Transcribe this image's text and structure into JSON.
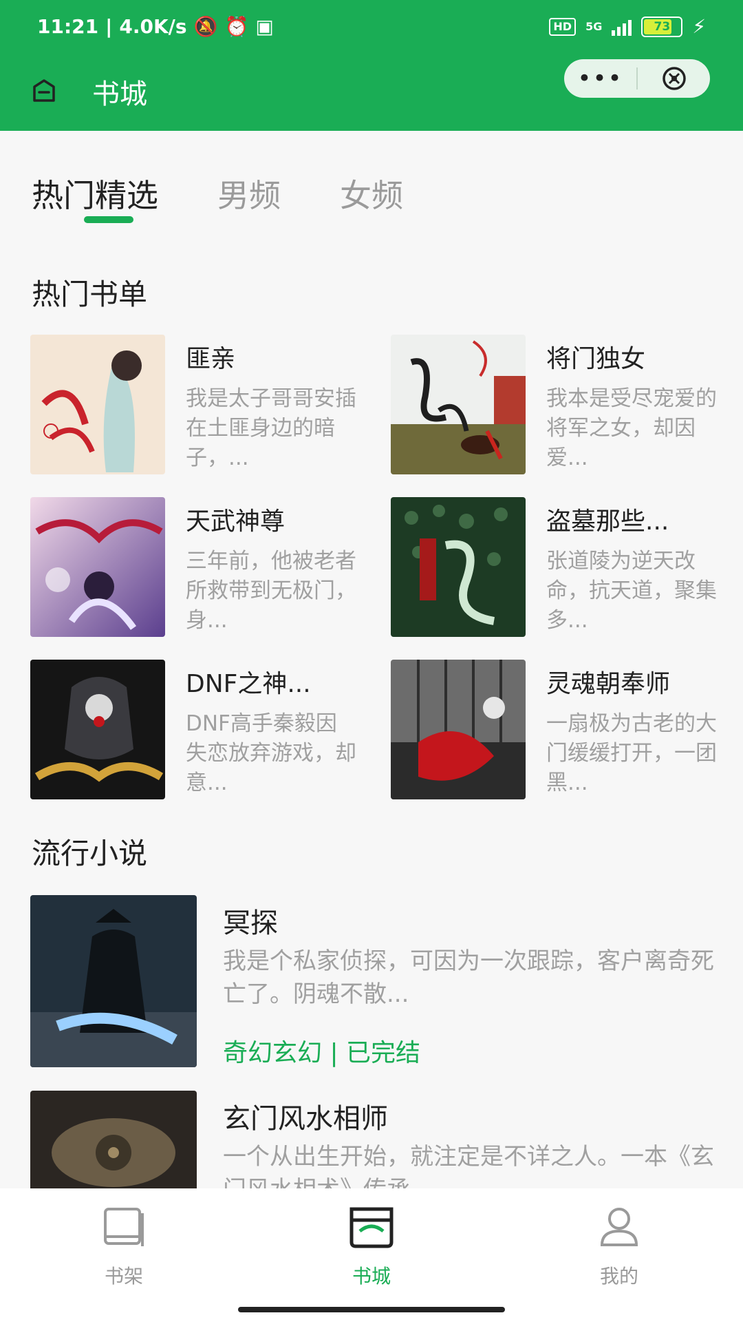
{
  "status_bar": {
    "time": "11:21",
    "net_speed": "4.0K/s",
    "hd_badge": "HD",
    "network": "5G",
    "battery": "73"
  },
  "header": {
    "title": "书城",
    "more_label": "•••"
  },
  "tabs": [
    {
      "label": "热门精选",
      "active": true
    },
    {
      "label": "男频",
      "active": false
    },
    {
      "label": "女频",
      "active": false
    }
  ],
  "hot_booklist": {
    "title": "热门书单",
    "items": [
      {
        "title": "匪亲",
        "desc": "我是太子哥哥安插在土匪身边的暗子，..."
      },
      {
        "title": "将门独女",
        "desc": "我本是受尽宠爱的将军之女，却因爱..."
      },
      {
        "title": "天武神尊",
        "desc": "三年前，他被老者所救带到无极门，身..."
      },
      {
        "title": "盗墓那些...",
        "desc": "张道陵为逆天改命，抗天道，聚集多..."
      },
      {
        "title": "DNF之神...",
        "desc": "DNF高手秦毅因失恋放弃游戏，却意..."
      },
      {
        "title": "灵魂朝奉师",
        "desc": "一扇极为古老的大门缓缓打开，一团黑..."
      }
    ]
  },
  "popular_novels": {
    "title": "流行小说",
    "items": [
      {
        "title": "冥探",
        "desc": "我是个私家侦探，可因为一次跟踪，客户离奇死亡了。阴魂不散...",
        "meta": "奇幻玄幻 | 已完结"
      },
      {
        "title": "玄门风水相师",
        "desc": "一个从出生开始，就注定是不详之人。一本《玄门风水相术》传承..."
      }
    ]
  },
  "bottom_nav": [
    {
      "label": "书架",
      "active": false
    },
    {
      "label": "书城",
      "active": true
    },
    {
      "label": "我的",
      "active": false
    }
  ],
  "colors": {
    "brand": "#1aad55",
    "text_main": "#222222",
    "text_muted": "#a0a0a0"
  }
}
